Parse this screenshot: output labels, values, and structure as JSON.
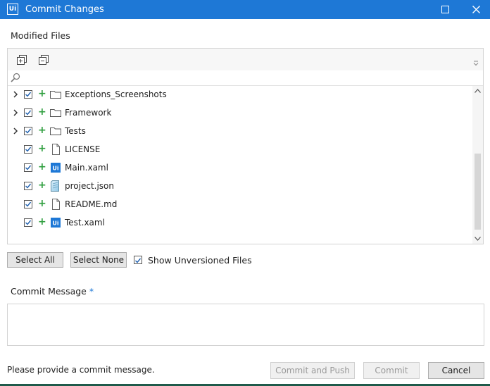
{
  "window": {
    "logo_text": "Ui",
    "title": "Commit Changes"
  },
  "modified_files": {
    "label": "Modified Files",
    "filter_placeholder": "",
    "items": [
      {
        "name": "Exceptions_Screenshots",
        "type": "folder",
        "expandable": true,
        "checked": true,
        "status": "+"
      },
      {
        "name": "Framework",
        "type": "folder",
        "expandable": true,
        "checked": true,
        "status": "+"
      },
      {
        "name": "Tests",
        "type": "folder",
        "expandable": true,
        "checked": true,
        "status": "+"
      },
      {
        "name": "LICENSE",
        "type": "file",
        "expandable": false,
        "checked": true,
        "status": "+"
      },
      {
        "name": "Main.xaml",
        "type": "xaml",
        "expandable": false,
        "checked": true,
        "status": "+"
      },
      {
        "name": "project.json",
        "type": "json",
        "expandable": false,
        "checked": true,
        "status": "+"
      },
      {
        "name": "README.md",
        "type": "file",
        "expandable": false,
        "checked": true,
        "status": "+"
      },
      {
        "name": "Test.xaml",
        "type": "xaml",
        "expandable": false,
        "checked": true,
        "status": "+"
      }
    ]
  },
  "selection": {
    "select_all_label": "Select All",
    "select_none_label": "Select None",
    "show_unversioned_label": "Show Unversioned Files",
    "show_unversioned_checked": true
  },
  "commit_message": {
    "label": "Commit Message",
    "required_mark": "*",
    "value": ""
  },
  "footer": {
    "status": "Please provide a commit message.",
    "commit_push_label": "Commit and Push",
    "commit_label": "Commit",
    "cancel_label": "Cancel"
  },
  "colors": {
    "accent": "#1e78d6",
    "added": "#2e9e3e"
  }
}
